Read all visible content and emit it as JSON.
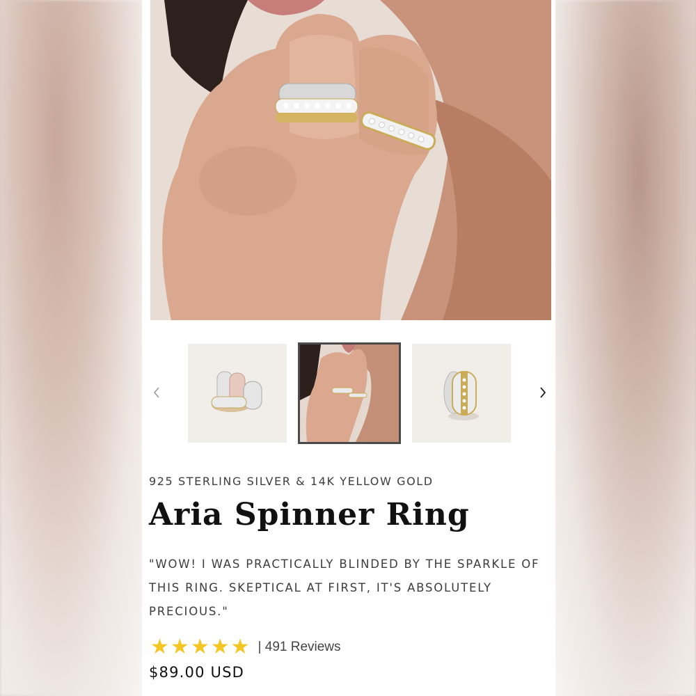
{
  "product": {
    "material": "925 STERLING SILVER & 14K YELLOW GOLD",
    "name": "Aria Spinner Ring",
    "quote": "\"WOW! I WAS PRACTICALLY BLINDED BY THE SPARKLE OF THIS RING. SKEPTICAL AT FIRST, IT'S ABSOLUTELY PRECIOUS.\"",
    "rating": 5,
    "stars": [
      "★",
      "★",
      "★",
      "★",
      "★"
    ],
    "reviews_label": "| 491 Reviews",
    "price": "$89.00 USD"
  },
  "gallery": {
    "selected_index": 1,
    "thumbnail_count": 3
  },
  "colors": {
    "star": "#f3c623",
    "selected_border": "#4a4a4a",
    "text": "#111111"
  },
  "icons": {
    "prev": "chevron-left-icon",
    "next": "chevron-right-icon",
    "star": "star-icon"
  }
}
